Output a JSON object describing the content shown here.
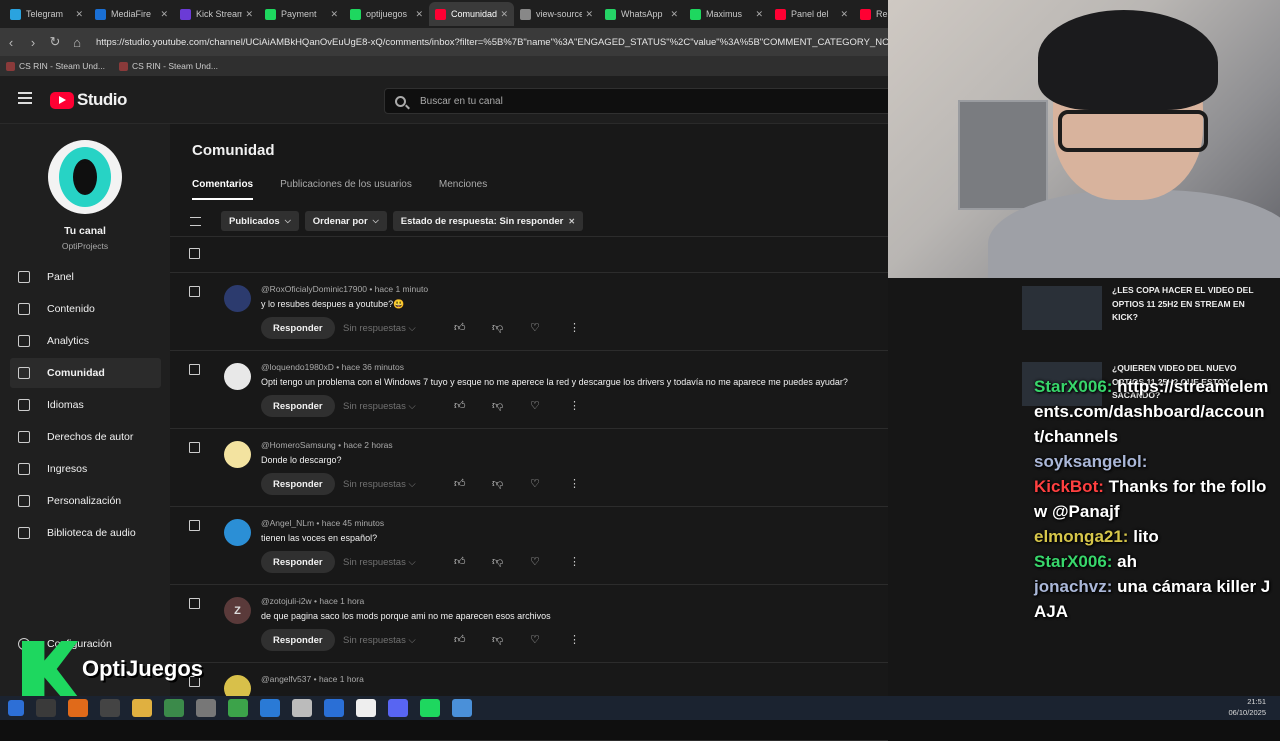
{
  "browser": {
    "tabs": [
      {
        "label": "Telegram",
        "color": "#2aa3df"
      },
      {
        "label": "MediaFire",
        "color": "#1a6fd4"
      },
      {
        "label": "Kick Stream",
        "color": "#6b3bd6"
      },
      {
        "label": "Payment",
        "color": "#1ed75f"
      },
      {
        "label": "optijuegos",
        "color": "#1ed75f"
      },
      {
        "label": "Comunidad",
        "color": "#ff0033"
      },
      {
        "label": "view-source",
        "color": "#888888"
      },
      {
        "label": "WhatsApp",
        "color": "#25d366"
      },
      {
        "label": "Maximus",
        "color": "#1ed75f"
      },
      {
        "label": "Panel del",
        "color": "#ff0033"
      },
      {
        "label": "Re",
        "color": "#ff0033"
      }
    ],
    "active_tab": 5,
    "url": "https://studio.youtube.com/channel/UCiAiAMBkHQanOvEuUgE8-xQ/comments/inbox?filter=%5B%7B\"name\"%3A\"ENGAGED_STATUS\"%2C\"value\"%3A%5B\"COMMENT_CATEGORY_NOT_",
    "bookmarks": [
      "CS RIN - Steam Und...",
      "CS RIN - Steam Und..."
    ]
  },
  "header": {
    "logo_text": "Studio",
    "search_placeholder": "Buscar en tu canal"
  },
  "sidebar": {
    "channel_title": "Tu canal",
    "channel_name": "OptiProjects",
    "items": [
      {
        "label": "Panel",
        "icon": "dashboard-icon"
      },
      {
        "label": "Contenido",
        "icon": "content-icon"
      },
      {
        "label": "Analytics",
        "icon": "analytics-icon"
      },
      {
        "label": "Comunidad",
        "icon": "community-icon",
        "selected": true
      },
      {
        "label": "Idiomas",
        "icon": "subtitles-icon"
      },
      {
        "label": "Derechos de autor",
        "icon": "copyright-icon"
      },
      {
        "label": "Ingresos",
        "icon": "dollar-icon"
      },
      {
        "label": "Personalización",
        "icon": "customization-icon"
      },
      {
        "label": "Biblioteca de audio",
        "icon": "audio-library-icon"
      }
    ],
    "settings_label": "Configuración"
  },
  "main": {
    "title": "Comunidad",
    "tabs": [
      "Comentarios",
      "Publicaciones de los usuarios",
      "Menciones"
    ],
    "filters": [
      "Publicados",
      "Ordenar por",
      "Estado de respuesta: Sin responder"
    ],
    "reply_label": "Responder",
    "no_replies_label": "Sin respuestas",
    "comments": [
      {
        "author": "@RoxOficialyDominic17900",
        "time": "hace 1 minuto",
        "text": "y lo resubes despues a youtube?😃",
        "avatar_color": "#2c3b6e",
        "initial": ""
      },
      {
        "author": "@loquendo1980xD",
        "time": "hace 36 minutos",
        "text": "Opti tengo un problema con el Windows 7 tuyo y esque no me aperece la red y descargue los drivers y todavía no me aparece me puedes ayudar?",
        "avatar_color": "#e8e8e8",
        "initial": ""
      },
      {
        "author": "@HomeroSamsung",
        "time": "hace 2 horas",
        "text": "Donde lo descargo?",
        "avatar_color": "#f3e3a0",
        "initial": ""
      },
      {
        "author": "@Angel_NLm",
        "time": "hace 45 minutos",
        "text": "tienen las voces en español?",
        "avatar_color": "#2b8fd6",
        "initial": ""
      },
      {
        "author": "@zotojuli-i2w",
        "time": "hace 1 hora",
        "text": "de que pagina saco los mods porque ami no me aparecen esos archivos",
        "avatar_color": "#5a3a3a",
        "initial": "Z"
      },
      {
        "author": "@angelfv537",
        "time": "hace 1 hora",
        "text": "",
        "avatar_color": "#d8c04a",
        "initial": ""
      }
    ]
  },
  "overlay": {
    "videos": [
      {
        "title": "¿LES COPA HACER EL VIDEO DEL OPTIOS 11 25H2 EN STREAM EN KICK?"
      },
      {
        "title": "¿QUIEREN VIDEO DEL NUEVO OPTIOS 11 25H2 QUE ESTOY SACANDO?"
      }
    ],
    "chat": [
      {
        "user": "StarX006:",
        "msg": "https://streamelements.com/dashboard/account/channels",
        "color": "#38d66b"
      },
      {
        "user": "soyksangelol:",
        "msg": "",
        "color": "#aab7d8"
      },
      {
        "user": "KickBot:",
        "msg": "Thanks for the follow @Panajf",
        "color": "#ff4040"
      },
      {
        "user": "elmonga21:",
        "msg": "lito",
        "color": "#d6c64a"
      },
      {
        "user": "StarX006:",
        "msg": "ah",
        "color": "#38d66b"
      },
      {
        "user": "jonachvz:",
        "msg": "una cámara killer JAJA",
        "color": "#aab7d8"
      }
    ],
    "brand_name": "OptiJuegos"
  },
  "taskbar": {
    "time": "21:51",
    "date": "06/10/2025"
  }
}
